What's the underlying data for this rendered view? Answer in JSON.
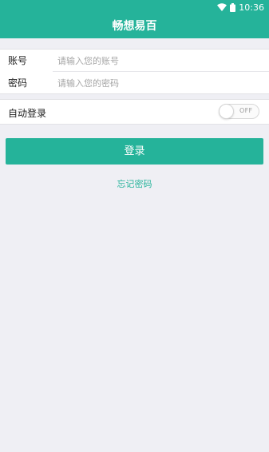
{
  "status_bar": {
    "time": "10:36",
    "wifi_icon": "wifi-icon",
    "battery_icon": "battery-icon"
  },
  "header": {
    "title": "畅想易百"
  },
  "login_form": {
    "account_label": "账号",
    "account_placeholder": "请输入您的账号",
    "account_value": "",
    "password_label": "密码",
    "password_placeholder": "请输入您的密码",
    "password_value": ""
  },
  "auto_login": {
    "label": "自动登录",
    "toggle_text": "OFF",
    "enabled": false
  },
  "login_button": {
    "label": "登录"
  },
  "forgot_password": {
    "label": "忘记密码"
  },
  "colors": {
    "accent": "#25b39a",
    "background": "#efeff4"
  }
}
